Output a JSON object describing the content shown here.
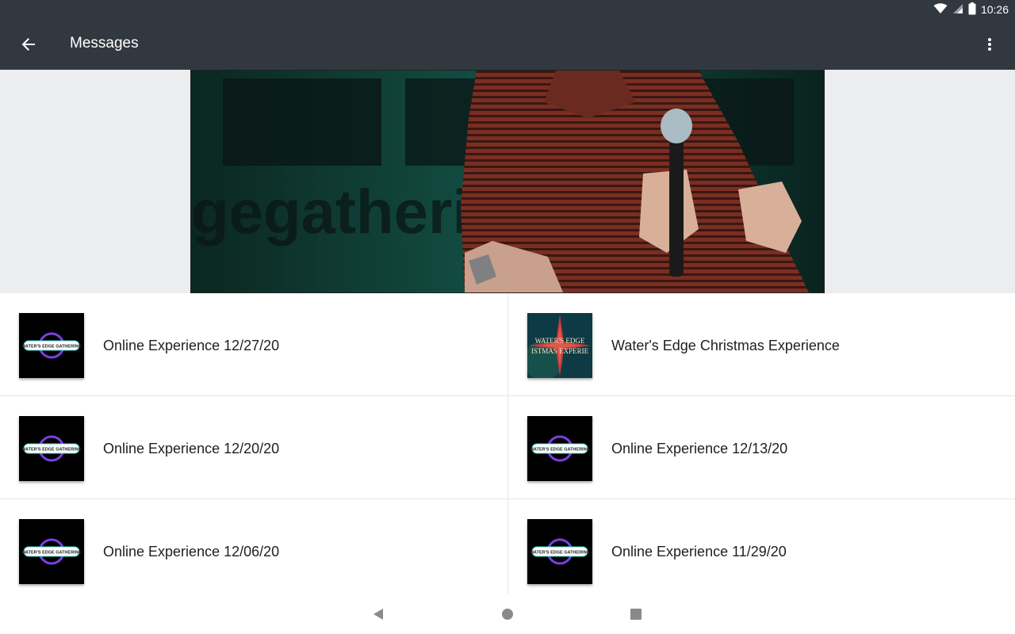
{
  "status_bar": {
    "time": "10:26",
    "icons": [
      "wifi-icon",
      "signal-icon",
      "battery-icon"
    ]
  },
  "app_bar": {
    "title": "Messages",
    "back_icon": "arrow-back-icon",
    "menu_icon": "more-vert-icon"
  },
  "hero": {
    "image": "speaker-with-microphone-photo",
    "background_text": "gegatherin"
  },
  "messages": [
    {
      "title": "Online Experience 12/27/20",
      "thumb": "waters-edge-gathering-logo",
      "thumb_text": "WATER'S EDGE GATHERING"
    },
    {
      "title": "Water's Edge Christmas Experience",
      "thumb": "christmas-star-artwork",
      "thumb_text_1": "WATER'S EDGE",
      "thumb_text_2": "ISTMAS EXPERIE"
    },
    {
      "title": "Online Experience 12/20/20",
      "thumb": "waters-edge-gathering-logo",
      "thumb_text": "WATER'S EDGE GATHERING"
    },
    {
      "title": "Online Experience 12/13/20",
      "thumb": "waters-edge-gathering-logo",
      "thumb_text": "WATER'S EDGE GATHERING"
    },
    {
      "title": "Online Experience 12/06/20",
      "thumb": "waters-edge-gathering-logo",
      "thumb_text": "WATER'S EDGE GATHERING"
    },
    {
      "title": "Online Experience 11/29/20",
      "thumb": "waters-edge-gathering-logo",
      "thumb_text": "WATER'S EDGE GATHERING"
    }
  ],
  "nav_bar": {
    "icons": [
      "nav-back-icon",
      "nav-home-icon",
      "nav-recents-icon"
    ]
  },
  "colors": {
    "app_bar": "#323840",
    "background": "#ecedef",
    "logo_purple": "#7b3fe0",
    "logo_teal": "#3fd0c8"
  }
}
